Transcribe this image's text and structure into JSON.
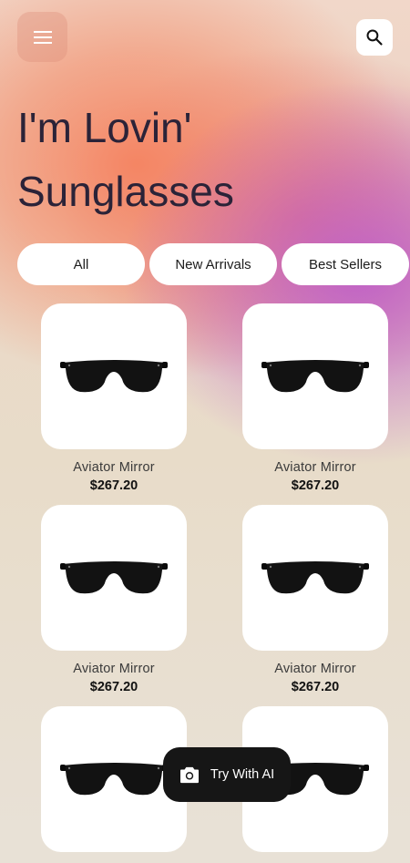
{
  "header": {
    "menu_icon": "hamburger-menu-icon",
    "search_icon": "search-icon",
    "title_line1": "I'm Lovin'",
    "title_line2": "Sunglasses"
  },
  "filters": [
    {
      "label": "All"
    },
    {
      "label": "New Arrivals"
    },
    {
      "label": "Best Sellers"
    }
  ],
  "products": [
    {
      "name": "Aviator Mirror",
      "price": "$267.20"
    },
    {
      "name": "Aviator Mirror",
      "price": "$267.20"
    },
    {
      "name": "Aviator Mirror",
      "price": "$267.20"
    },
    {
      "name": "Aviator Mirror",
      "price": "$267.20"
    },
    {
      "name": "",
      "price": ""
    },
    {
      "name": "",
      "price": ""
    }
  ],
  "fab": {
    "icon": "camera-icon",
    "label": "Try With AI"
  },
  "colors": {
    "background": "#e8e1d6",
    "accent_orange": "#f58a6a",
    "accent_purple": "#be5fc8",
    "title": "#2b2338",
    "fab": "#161616"
  }
}
